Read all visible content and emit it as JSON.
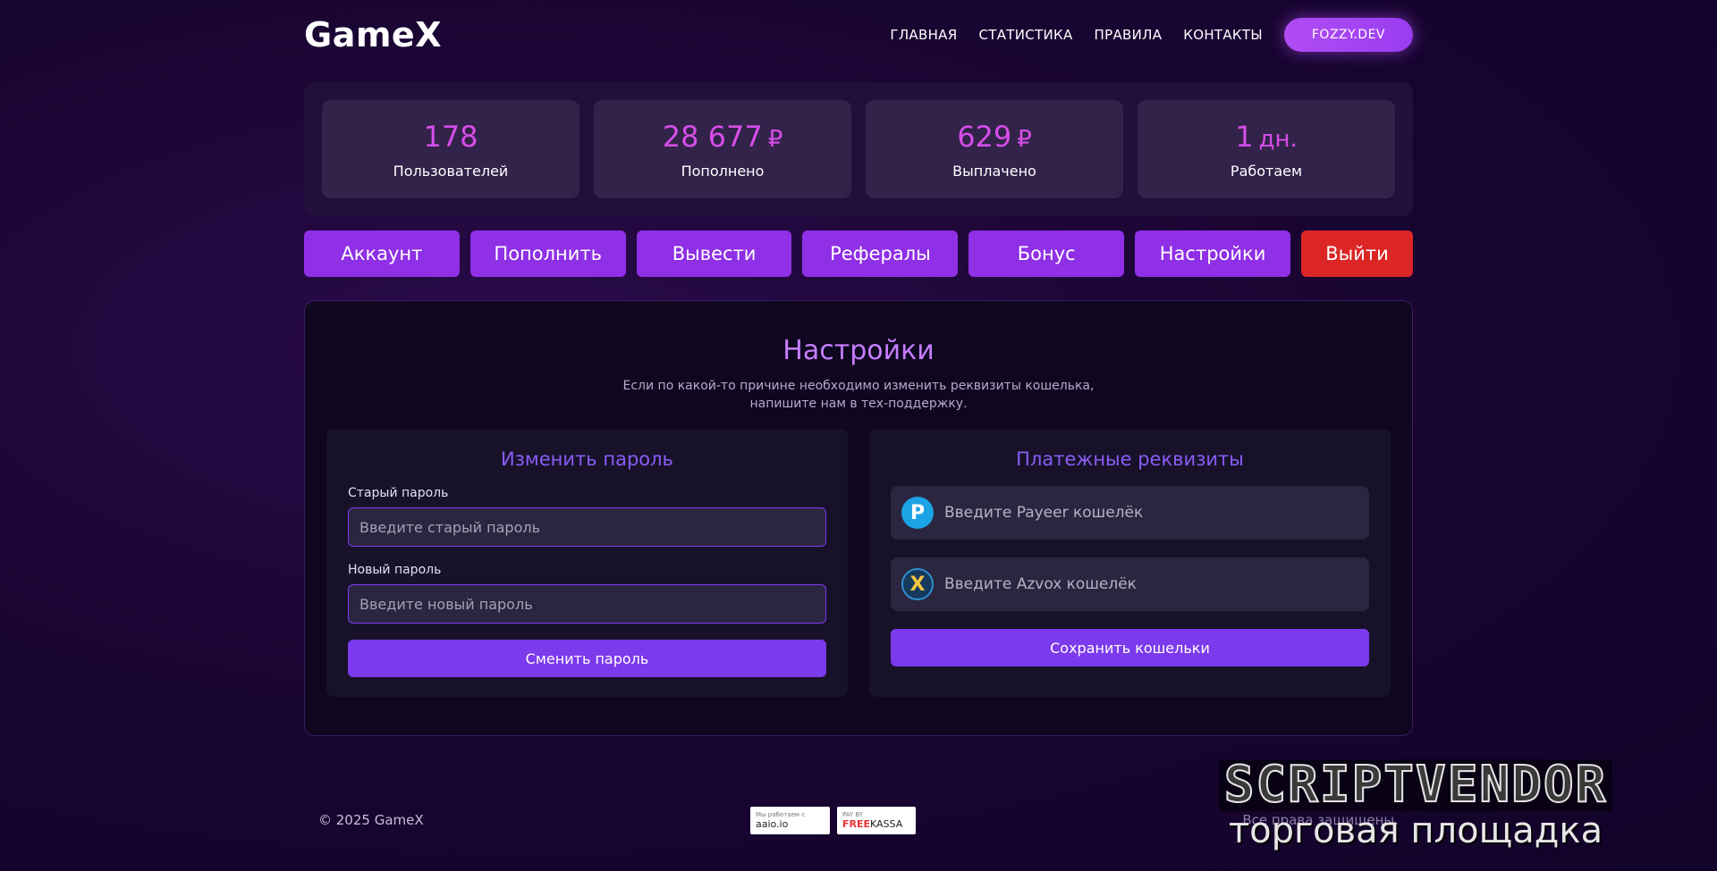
{
  "header": {
    "logo": "GameX",
    "nav": [
      "ГЛАВНАЯ",
      "СТАТИСТИКА",
      "ПРАВИЛА",
      "КОНТАКТЫ"
    ],
    "cta": "FOZZY.DEV"
  },
  "stats": [
    {
      "value": "178",
      "unit": "",
      "label": "Пользователей"
    },
    {
      "value": "28 677",
      "unit": "₽",
      "label": "Пополнено"
    },
    {
      "value": "629",
      "unit": "₽",
      "label": "Выплачено"
    },
    {
      "value": "1",
      "unit": "дн.",
      "label": "Работаем"
    }
  ],
  "tabs": [
    "Аккаунт",
    "Пополнить",
    "Вывести",
    "Рефералы",
    "Бонус",
    "Настройки",
    "Выйти"
  ],
  "settings": {
    "title": "Настройки",
    "description_line1": "Если по какой-то причине необходимо изменить реквизиты кошелька,",
    "description_line2": "напишите нам в тех-поддержку.",
    "password_card": {
      "title": "Изменить пароль",
      "old_label": "Старый пароль",
      "old_placeholder": "Введите старый пароль",
      "new_label": "Новый пароль",
      "new_placeholder": "Введите новый пароль",
      "button": "Сменить пароль"
    },
    "wallet_card": {
      "title": "Платежные реквизиты",
      "payeer_placeholder": "Введите Payeer кошелёк",
      "azvox_placeholder": "Введите Azvox кошелёк",
      "button": "Сохранить кошельки"
    }
  },
  "footer": {
    "copyright": "© 2025 GameX",
    "aaio_small": "Мы работаем с",
    "aaio": "aaio.io",
    "fk_small": "PAY BY",
    "fk_red": "FREE",
    "fk_rest": "KASSA",
    "rights": "Все права защищены."
  },
  "watermark": {
    "title": "SCRIPTVENDOR",
    "subtitle": "торговая площадка"
  },
  "colors": {
    "accent": "#8f2fe6",
    "logout": "#dc2626",
    "stat_value": "#d64ee8"
  }
}
